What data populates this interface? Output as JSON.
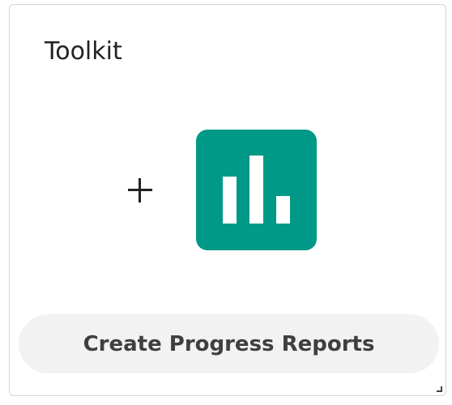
{
  "card": {
    "title": "Toolkit"
  },
  "icons": {
    "add": "plus-icon",
    "app": "bar-chart-icon",
    "resize": "resize-handle-icon"
  },
  "app_tile": {
    "color": "#009886"
  },
  "action": {
    "label": "Create Progress Reports"
  }
}
